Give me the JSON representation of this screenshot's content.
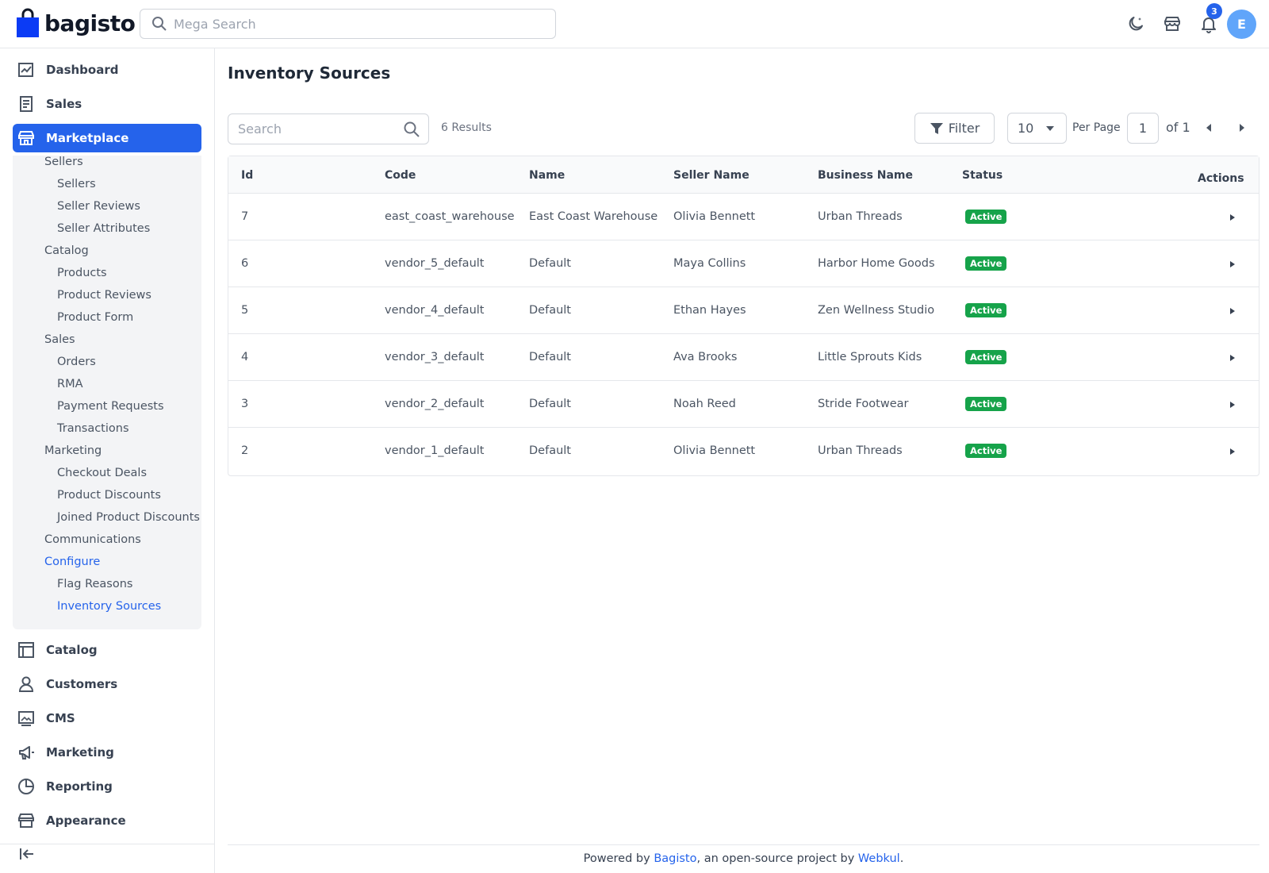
{
  "header": {
    "brand": "bagisto",
    "search_placeholder": "Mega Search",
    "notification_count": "3",
    "avatar_initial": "E"
  },
  "sidebar": {
    "top_items": [
      {
        "label": "Dashboard",
        "icon": "dashboard-icon"
      },
      {
        "label": "Sales",
        "icon": "sales-icon"
      },
      {
        "label": "Marketplace",
        "icon": "marketplace-icon",
        "active": true
      }
    ],
    "marketplace_sub": [
      {
        "label": "Sellers"
      },
      {
        "label": "Sellers"
      },
      {
        "label": "Seller Reviews"
      },
      {
        "label": "Seller Attributes"
      },
      {
        "label": "Catalog"
      },
      {
        "label": "Products"
      },
      {
        "label": "Product Reviews"
      },
      {
        "label": "Product Form"
      },
      {
        "label": "Sales"
      },
      {
        "label": "Orders"
      },
      {
        "label": "RMA"
      },
      {
        "label": "Payment Requests"
      },
      {
        "label": "Transactions"
      },
      {
        "label": "Marketing"
      },
      {
        "label": "Checkout Deals"
      },
      {
        "label": "Product Discounts"
      },
      {
        "label": "Joined Product Discounts"
      },
      {
        "label": "Communications"
      },
      {
        "label": "Configure"
      },
      {
        "label": "Flag Reasons"
      },
      {
        "label": "Inventory Sources"
      }
    ],
    "bottom_items": [
      {
        "label": "Catalog",
        "icon": "catalog-icon"
      },
      {
        "label": "Customers",
        "icon": "customers-icon"
      },
      {
        "label": "CMS",
        "icon": "cms-icon"
      },
      {
        "label": "Marketing",
        "icon": "marketing-icon"
      },
      {
        "label": "Reporting",
        "icon": "reporting-icon"
      },
      {
        "label": "Appearance",
        "icon": "appearance-icon"
      }
    ]
  },
  "main": {
    "title": "Inventory Sources",
    "search_placeholder": "Search",
    "results": "6 Results",
    "filter_label": "Filter",
    "per_page_value": "10",
    "per_page_label": "Per Page",
    "page_value": "1",
    "page_of": "of 1",
    "columns": [
      "Id",
      "Code",
      "Name",
      "Seller Name",
      "Business Name",
      "Status",
      "Actions"
    ],
    "rows": [
      {
        "id": "7",
        "code": "east_coast_warehouse",
        "name": "East Coast Warehouse",
        "seller": "Olivia Bennett",
        "business": "Urban Threads",
        "status": "Active"
      },
      {
        "id": "6",
        "code": "vendor_5_default",
        "name": "Default",
        "seller": "Maya Collins",
        "business": "Harbor Home Goods",
        "status": "Active"
      },
      {
        "id": "5",
        "code": "vendor_4_default",
        "name": "Default",
        "seller": "Ethan Hayes",
        "business": "Zen Wellness Studio",
        "status": "Active"
      },
      {
        "id": "4",
        "code": "vendor_3_default",
        "name": "Default",
        "seller": "Ava Brooks",
        "business": "Little Sprouts Kids",
        "status": "Active"
      },
      {
        "id": "3",
        "code": "vendor_2_default",
        "name": "Default",
        "seller": "Noah Reed",
        "business": "Stride Footwear",
        "status": "Active"
      },
      {
        "id": "2",
        "code": "vendor_1_default",
        "name": "Default",
        "seller": "Olivia Bennett",
        "business": "Urban Threads",
        "status": "Active"
      }
    ]
  },
  "footer": {
    "prefix": "Powered by ",
    "link1": "Bagisto",
    "middle": ", an open-source project by ",
    "link2": "Webkul",
    "suffix": "."
  },
  "colors": {
    "accent": "#2563eb",
    "status_active": "#16a34a"
  }
}
